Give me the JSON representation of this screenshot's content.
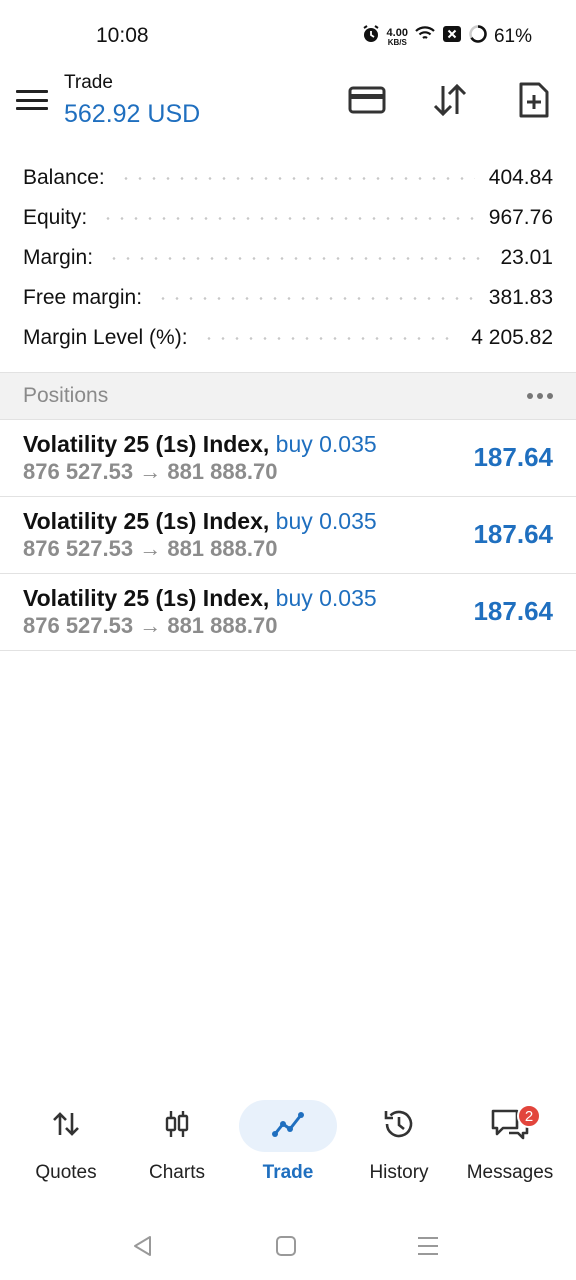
{
  "status_bar": {
    "time": "10:08",
    "net_speed_value": "4.00",
    "net_speed_unit": "KB/S",
    "battery": "61%",
    "icons": [
      "alarm-icon",
      "wifi-icon",
      "notification-x-icon",
      "battery-icon"
    ]
  },
  "header": {
    "title": "Trade",
    "balance": "562.92 USD",
    "icons": [
      "menu-icon",
      "wallet-card-icon",
      "sort-arrows-icon",
      "new-order-icon"
    ]
  },
  "summary": [
    {
      "label": "Balance:",
      "value": "404.84"
    },
    {
      "label": "Equity:",
      "value": "967.76"
    },
    {
      "label": "Margin:",
      "value": "23.01"
    },
    {
      "label": "Free margin:",
      "value": "381.83"
    },
    {
      "label": "Margin Level (%):",
      "value": "4 205.82"
    }
  ],
  "positions": {
    "title": "Positions",
    "items": [
      {
        "symbol": "Volatility 25 (1s) Index,",
        "side": "buy 0.035",
        "prices": "876 527.53 → 881 888.70",
        "profit": "187.64"
      },
      {
        "symbol": "Volatility 25 (1s) Index,",
        "side": "buy 0.035",
        "prices": "876 527.53 → 881 888.70",
        "profit": "187.64"
      },
      {
        "symbol": "Volatility 25 (1s) Index,",
        "side": "buy 0.035",
        "prices": "876 527.53 → 881 888.70",
        "profit": "187.64"
      }
    ]
  },
  "bottom_nav": {
    "items": [
      {
        "label": "Quotes",
        "icon": "quotes-arrows-icon"
      },
      {
        "label": "Charts",
        "icon": "candlestick-icon"
      },
      {
        "label": "Trade",
        "icon": "trade-line-icon",
        "active": true
      },
      {
        "label": "History",
        "icon": "history-clock-icon"
      },
      {
        "label": "Messages",
        "icon": "messages-icon",
        "badge": "2"
      }
    ]
  },
  "colors": {
    "accent": "#1f6fbf",
    "badge": "#e2453c",
    "muted": "#8c8c8c"
  }
}
